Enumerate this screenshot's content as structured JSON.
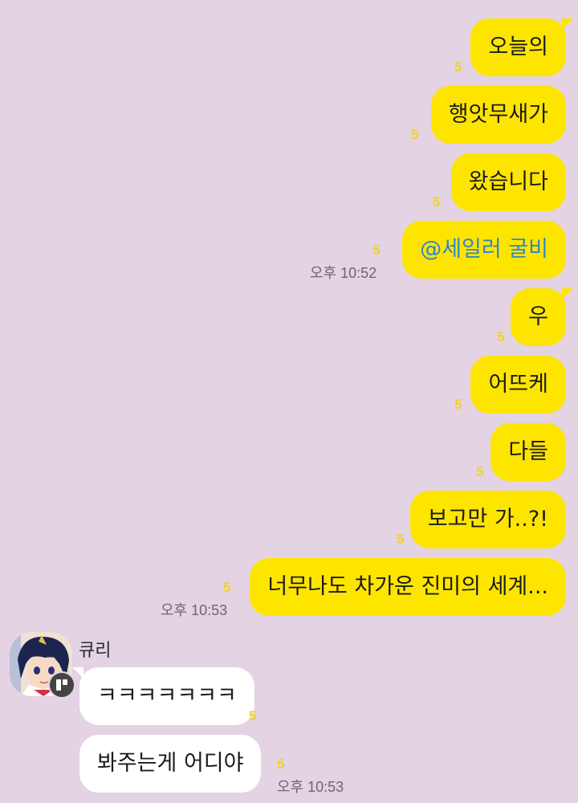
{
  "chat": {
    "messages": [
      {
        "text": "오늘의",
        "unread": "5"
      },
      {
        "text": "행앗무새가",
        "unread": "5"
      },
      {
        "text": "왔습니다",
        "unread": "5"
      },
      {
        "text": "@세일러 굴비",
        "unread": "5",
        "time": "오후 10:52"
      },
      {
        "text": "우",
        "unread": "5"
      },
      {
        "text": "어뜨케",
        "unread": "5"
      },
      {
        "text": "다들",
        "unread": "5"
      },
      {
        "text": "보고만 가..?!",
        "unread": "5"
      },
      {
        "text": "너무나도 차가운 진미의 세계...",
        "unread": "5",
        "time": "오후 10:53"
      }
    ],
    "other": {
      "sender": "큐리",
      "messages": [
        {
          "text": "ㅋㅋㅋㅋㅋㅋㅋ",
          "unread": "5"
        },
        {
          "text": "봐주는게 어디야",
          "unread": "5",
          "time": "오후 10:53"
        }
      ]
    }
  },
  "colors": {
    "background": "#e3d3e3",
    "my_bubble": "#fee500",
    "their_bubble": "#ffffff",
    "unread": "#f3d22a",
    "mention": "#2f86c9"
  },
  "icons": {
    "avatar": "anime-girl-avatar",
    "badge": "channel-badge-icon"
  }
}
